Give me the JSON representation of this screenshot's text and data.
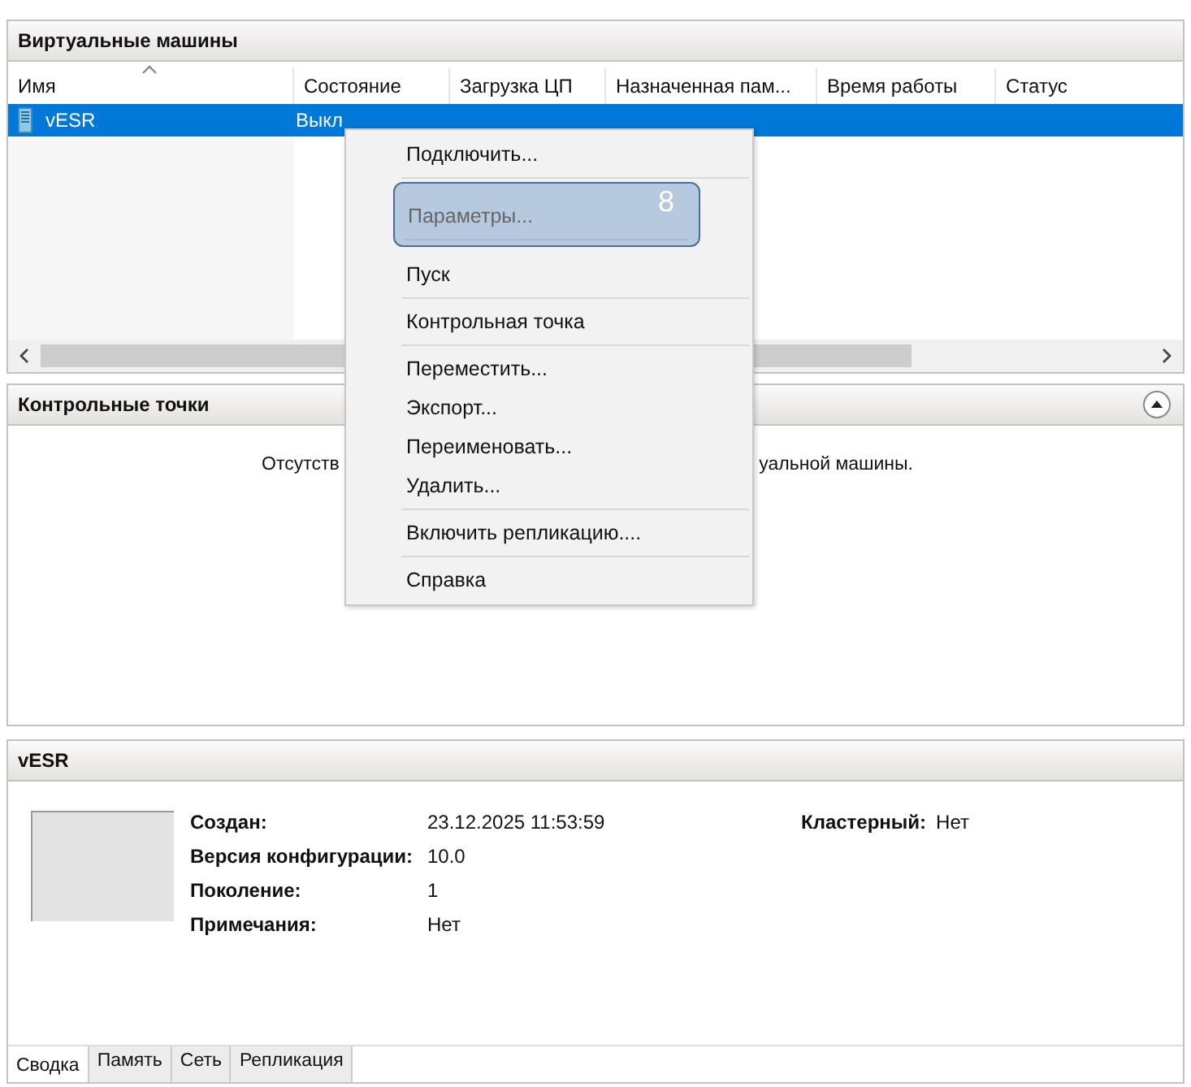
{
  "vm_panel": {
    "title": "Виртуальные машины",
    "columns": [
      {
        "label": "Имя",
        "sorted": true
      },
      {
        "label": "Состояние",
        "sorted": false
      },
      {
        "label": "Загрузка ЦП",
        "sorted": false
      },
      {
        "label": "Назначенная пам...",
        "sorted": false
      },
      {
        "label": "Время работы",
        "sorted": false
      },
      {
        "label": "Статус",
        "sorted": false
      }
    ],
    "rows": [
      {
        "name": "vESR",
        "state": "Выкл",
        "selected": true
      }
    ]
  },
  "checkpoints_panel": {
    "title": "Контрольные точки",
    "message_left": "Отсутств",
    "message_right": "уальной машины."
  },
  "details_panel": {
    "title": "vESR",
    "fields": [
      {
        "label": "Создан:",
        "value": "23.12.2025 11:53:59"
      },
      {
        "label": "Версия конфигурации:",
        "value": "10.0"
      },
      {
        "label": "Поколение:",
        "value": "1"
      },
      {
        "label": "Примечания:",
        "value": "Нет"
      }
    ],
    "side_field": {
      "label": "Кластерный:",
      "value": "Нет"
    },
    "tabs": [
      {
        "label": "Сводка",
        "selected": true
      },
      {
        "label": "Память",
        "selected": false
      },
      {
        "label": "Сеть",
        "selected": false
      },
      {
        "label": "Репликация",
        "selected": false
      }
    ]
  },
  "context_menu": {
    "items": [
      {
        "label": "Подключить...",
        "highlighted": false,
        "separator_after": true
      },
      {
        "label": "Параметры...",
        "highlighted": true,
        "badge": "8",
        "separator_after": true
      },
      {
        "label": "Пуск",
        "highlighted": false,
        "separator_after": true
      },
      {
        "label": "Контрольная точка",
        "highlighted": false,
        "separator_after": true
      },
      {
        "label": "Переместить...",
        "highlighted": false,
        "separator_after": false
      },
      {
        "label": "Экспорт...",
        "highlighted": false,
        "separator_after": false
      },
      {
        "label": "Переименовать...",
        "highlighted": false,
        "separator_after": false
      },
      {
        "label": "Удалить...",
        "highlighted": false,
        "separator_after": true
      },
      {
        "label": "Включить репликацию....",
        "highlighted": false,
        "separator_after": true
      },
      {
        "label": "Справка",
        "highlighted": false,
        "separator_after": false
      }
    ]
  }
}
